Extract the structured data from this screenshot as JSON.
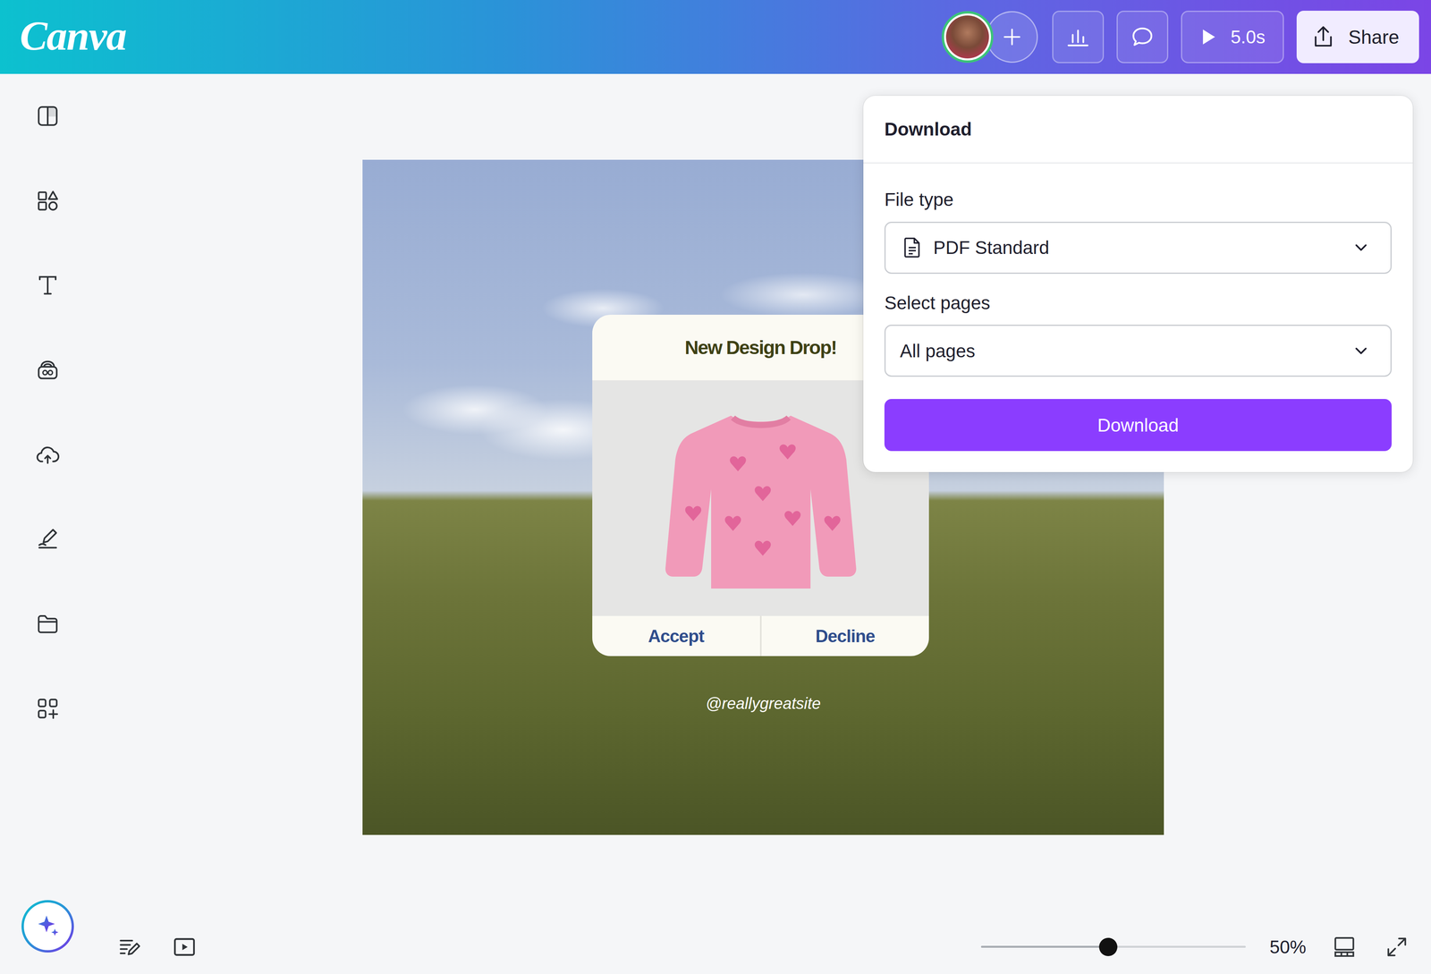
{
  "logo": "Canva",
  "topbar": {
    "timer": "5.0s",
    "share": "Share"
  },
  "download_panel": {
    "title": "Download",
    "fields": [
      {
        "label": "File type",
        "value": "PDF Standard",
        "kind": "file"
      },
      {
        "label": "Select pages",
        "value": "All pages",
        "kind": "plain"
      }
    ],
    "button": "Download"
  },
  "canvas": {
    "card": {
      "title": "New Design Drop!",
      "buttons": [
        "Accept",
        "Decline"
      ]
    },
    "handle": "@reallygreatsite"
  },
  "zoom": {
    "level": 0.48,
    "reading": "50%"
  }
}
